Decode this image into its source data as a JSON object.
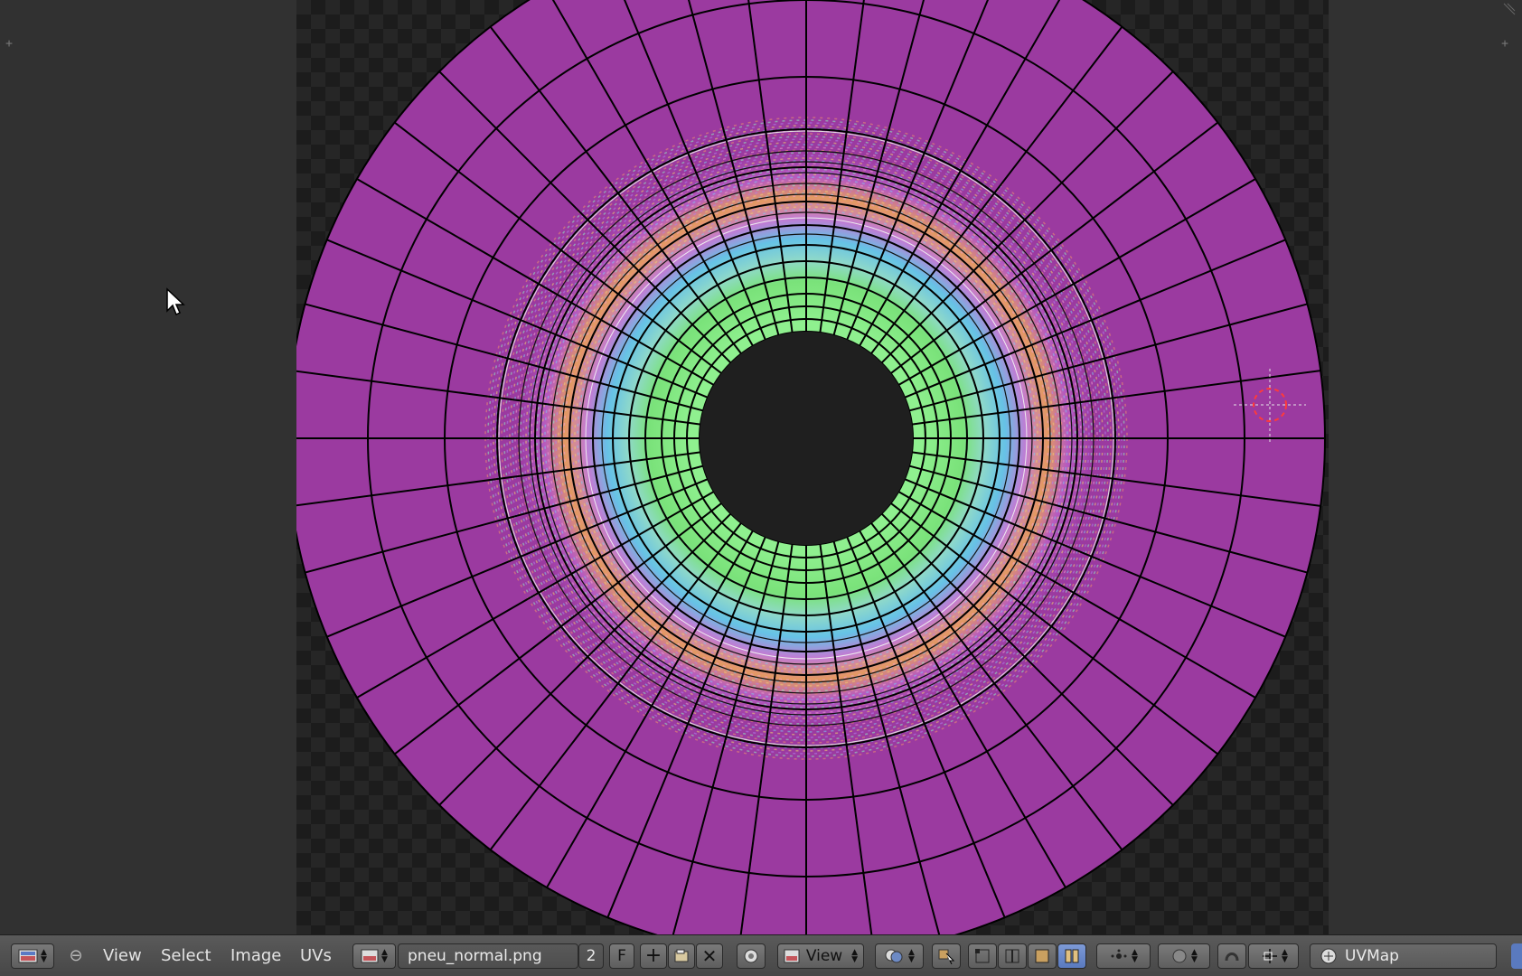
{
  "menus": {
    "view": "View",
    "select": "Select",
    "image": "Image",
    "uvs": "UVs"
  },
  "image_name": "pneu_normal.png",
  "user_count": "2",
  "fake_user": "F",
  "view_mode": "View",
  "uv_map": "UVMap",
  "colors": {
    "outer_ring": "#9b3aa0",
    "inner_ring": "#7ee87e",
    "mesh_edge": "#000000",
    "checker_dark": "#1c1c1c",
    "checker_light": "#262626",
    "header_bg": "#4f4f4f"
  },
  "icons": [
    "editor-type-icon",
    "collapse-icon",
    "image-browse-icon",
    "new-image-icon",
    "open-image-icon",
    "unlink-icon",
    "pin-icon",
    "image-view-icon",
    "draw-channels-icon",
    "uv-sync-icon",
    "vertex-select-icon",
    "edge-select-icon",
    "face-select-icon",
    "island-select-icon",
    "sticky-mode-icon",
    "pivot-icon",
    "proportional-icon",
    "snap-icon",
    "snap-target-icon",
    "uvmap-icon"
  ]
}
